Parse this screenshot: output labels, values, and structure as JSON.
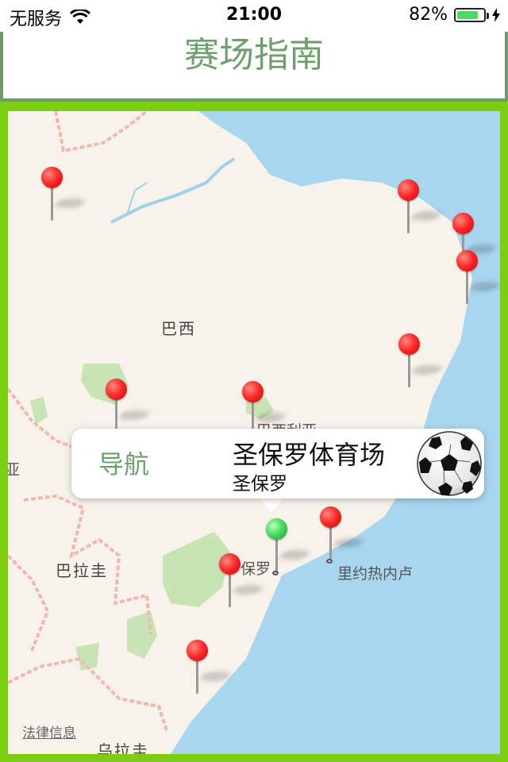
{
  "status": {
    "carrier": "无服务",
    "time": "21:00",
    "battery": "82%",
    "battery_level": 0.82,
    "wifi_icon": "wifi-icon",
    "charging_icon": "bolt-icon"
  },
  "navbar": {
    "title": "赛场指南"
  },
  "map": {
    "labels": {
      "brazil": "巴西",
      "brasilia": "巴西利亚",
      "paraguay": "巴拉圭",
      "sao_paulo_fragment": "保罗",
      "rio": "里约热内卢",
      "uruguay_fragment": "乌拉圭",
      "edge_fragment": "亚"
    },
    "legal": "法律信息",
    "colors": {
      "land": "#f7f2ea",
      "water": "#a8d6ee",
      "park": "#c9e4b4",
      "border": "#f0b9b0",
      "river": "#9ed1ec"
    }
  },
  "callout": {
    "navigate_label": "导航",
    "title": "圣保罗体育场",
    "subtitle": "圣保罗",
    "image_icon": "soccer-ball-icon"
  }
}
